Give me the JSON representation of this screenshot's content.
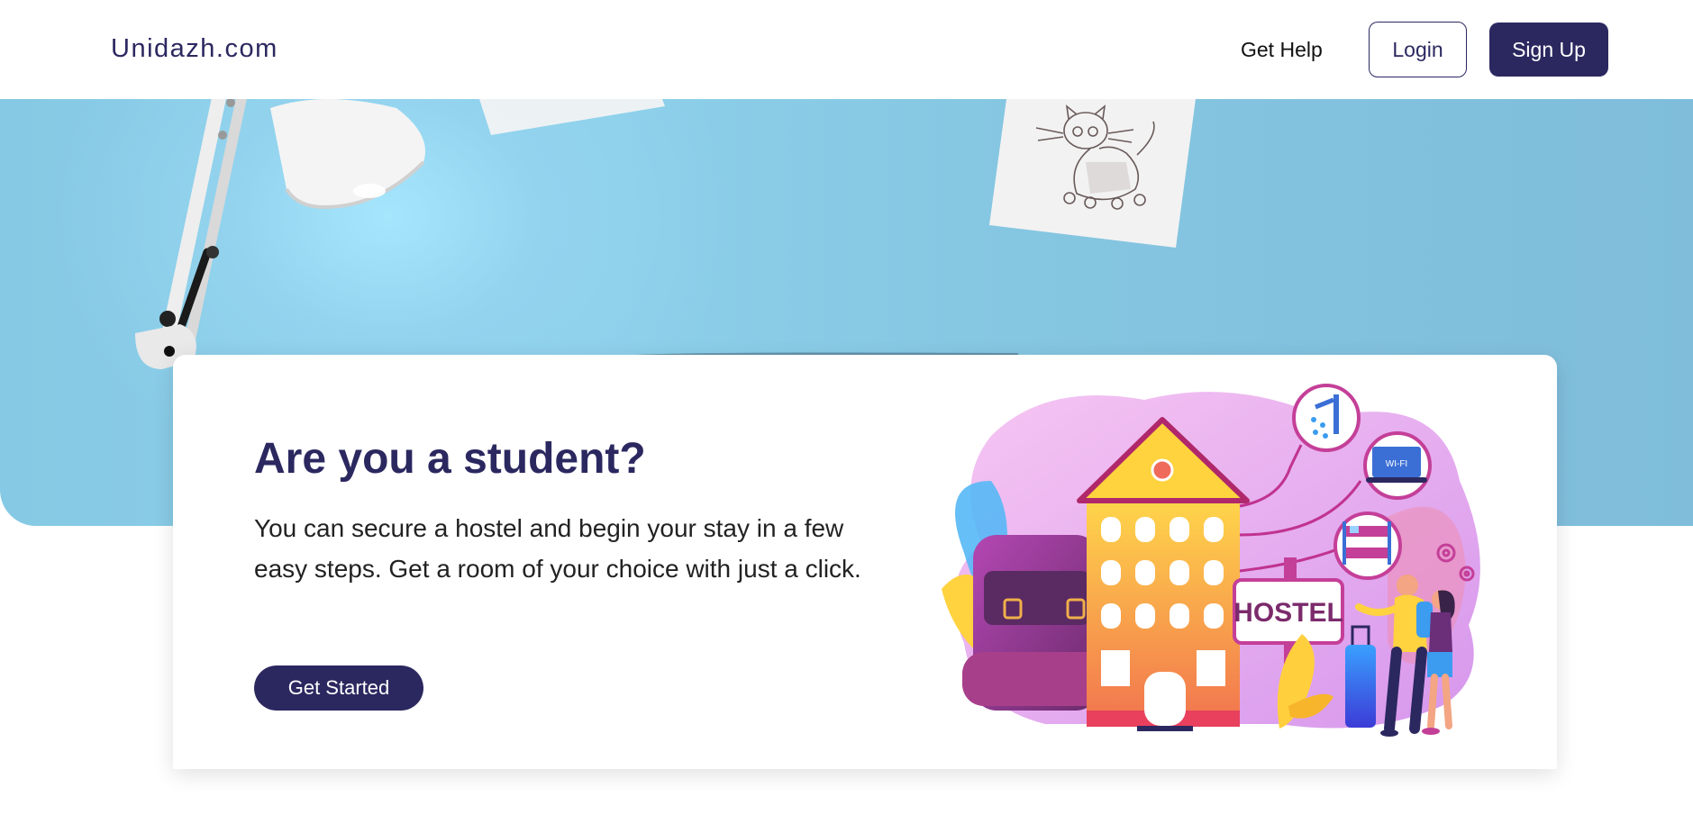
{
  "header": {
    "logo": "Unidazh.com",
    "help_label": "Get Help",
    "login_label": "Login",
    "signup_label": "Sign Up"
  },
  "card": {
    "title": "Are you a student?",
    "description": "You can secure a hostel and begin your stay in a few easy steps. Get a room of your choice with just a click.",
    "cta_label": "Get Started"
  },
  "illustration": {
    "sign_text": "HOSTEL",
    "wifi_text": "WI-FI",
    "icons": [
      "shower-icon",
      "wifi-laptop-icon",
      "bunk-bed-icon",
      "gear-icon"
    ]
  },
  "colors": {
    "primary": "#2b2860",
    "hero_blue": "#86c9e4",
    "white": "#ffffff"
  }
}
